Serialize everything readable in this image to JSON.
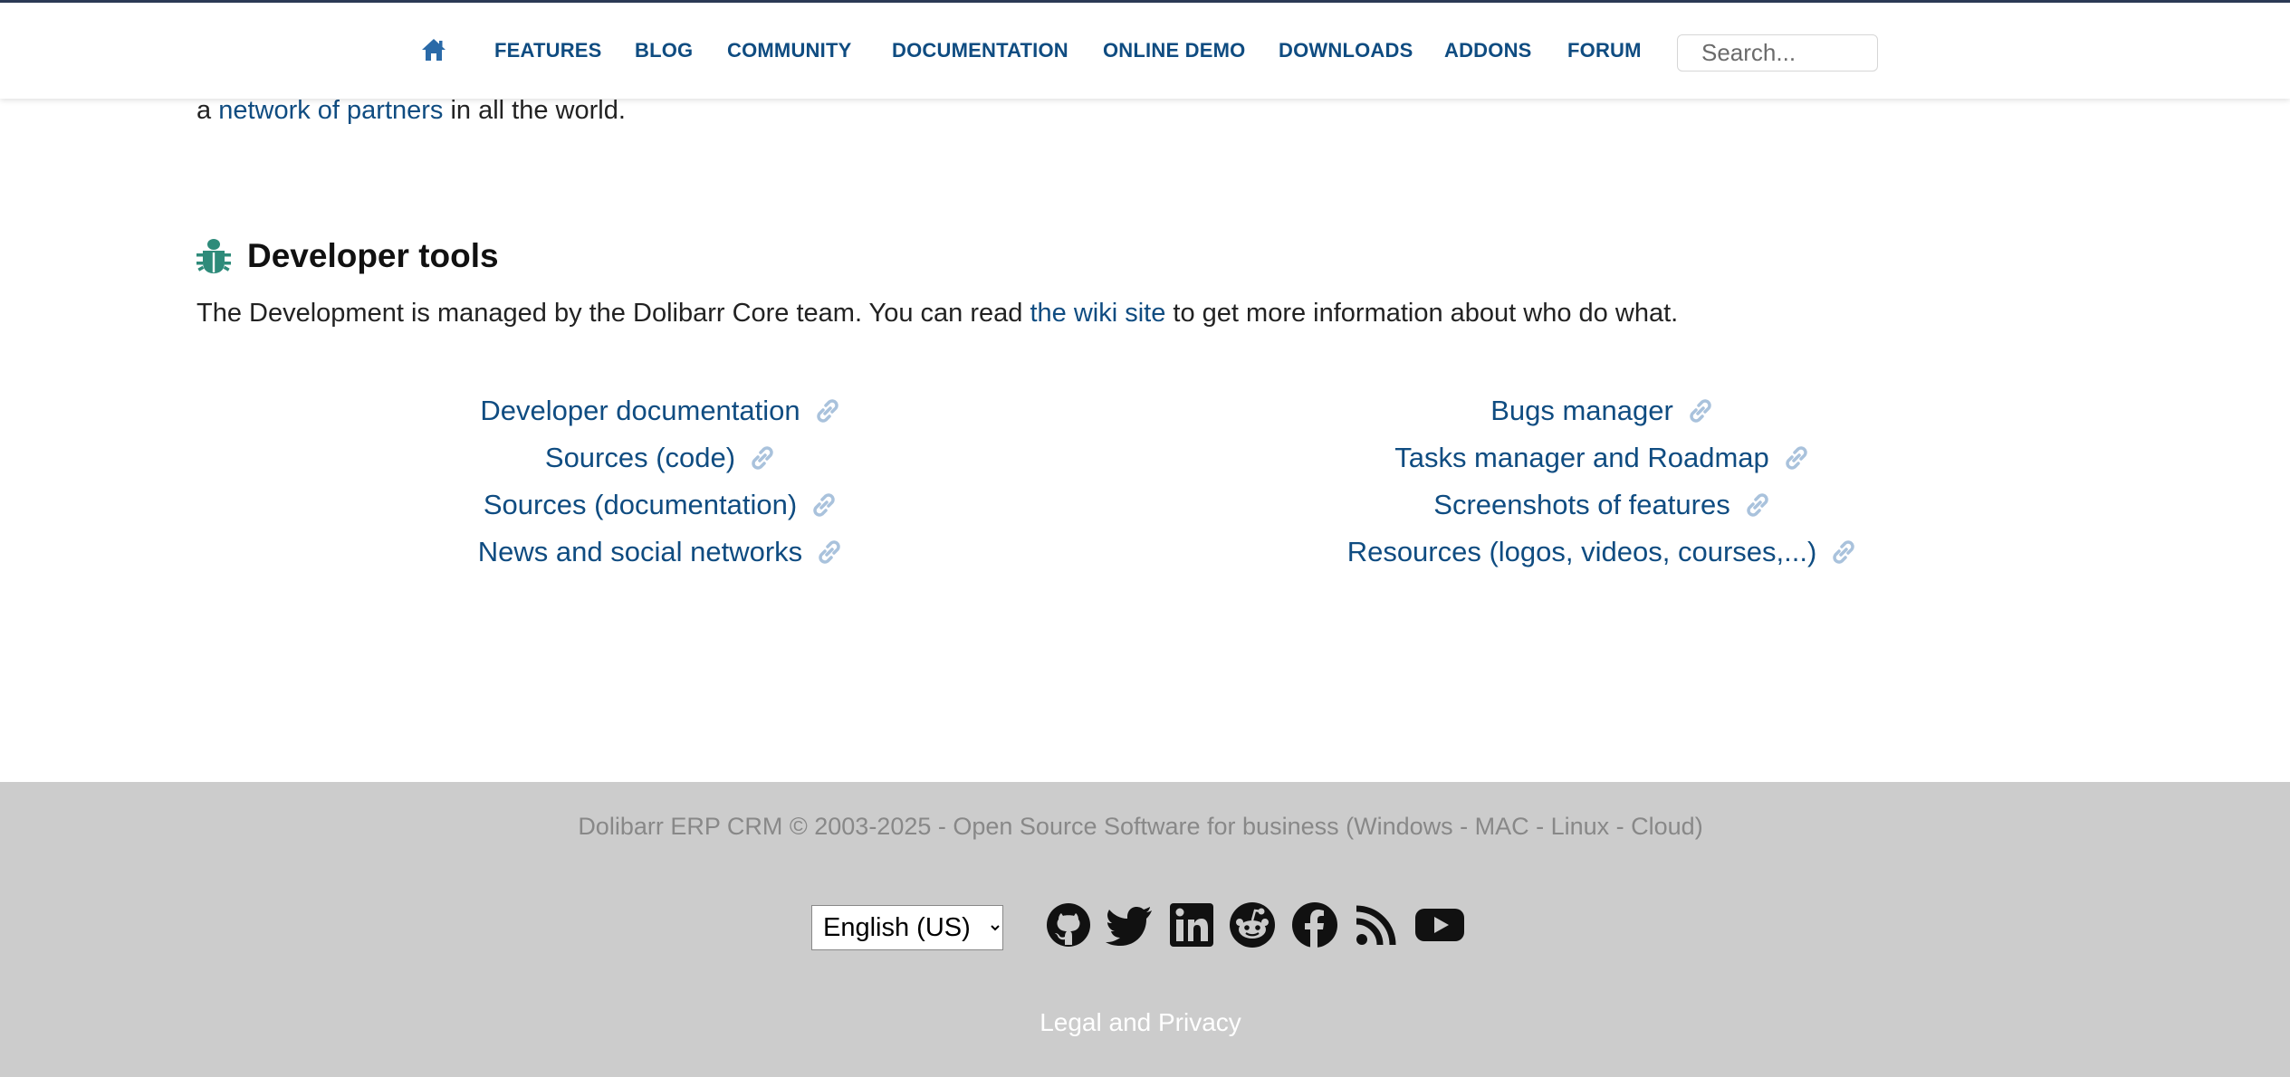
{
  "nav": {
    "items": [
      {
        "label": "FEATURES"
      },
      {
        "label": "BLOG"
      },
      {
        "label": "COMMUNITY"
      },
      {
        "label": "DOCUMENTATION"
      },
      {
        "label": "ONLINE DEMO"
      },
      {
        "label": "DOWNLOADS"
      },
      {
        "label": "ADDONS"
      },
      {
        "label": "FORUM"
      }
    ],
    "search_placeholder": "Search..."
  },
  "intro": {
    "prefix": "a ",
    "link": "network of partners",
    "suffix": " in all the world."
  },
  "developer_tools": {
    "title": "Developer tools",
    "desc_prefix": "The Development is managed by the Dolibarr Core team. You can read ",
    "desc_link": "the wiki site",
    "desc_suffix": " to get more information about who do what.",
    "left_links": [
      {
        "label": "Developer documentation"
      },
      {
        "label": "Sources (code)"
      },
      {
        "label": "Sources (documentation)"
      },
      {
        "label": "News and social networks"
      }
    ],
    "right_links": [
      {
        "label": "Bugs manager"
      },
      {
        "label": "Tasks manager and Roadmap"
      },
      {
        "label": "Screenshots of features"
      },
      {
        "label": "Resources (logos, videos, courses,...)"
      }
    ]
  },
  "footer": {
    "copyright": "Dolibarr ERP CRM © 2003-2025 - Open Source Software for business (Windows - MAC - Linux - Cloud)",
    "language": "English (US)",
    "social_icons": [
      "github-icon",
      "twitter-icon",
      "linkedin-icon",
      "reddit-icon",
      "facebook-icon",
      "rss-icon",
      "youtube-icon"
    ],
    "legal": "Legal and Privacy"
  },
  "colors": {
    "link": "#0f4c81",
    "bug_icon": "#2e8b7a",
    "chain_icon": "#a9c2dc",
    "footer_bg": "#cccccc",
    "nav_border": "#2b3a55"
  }
}
